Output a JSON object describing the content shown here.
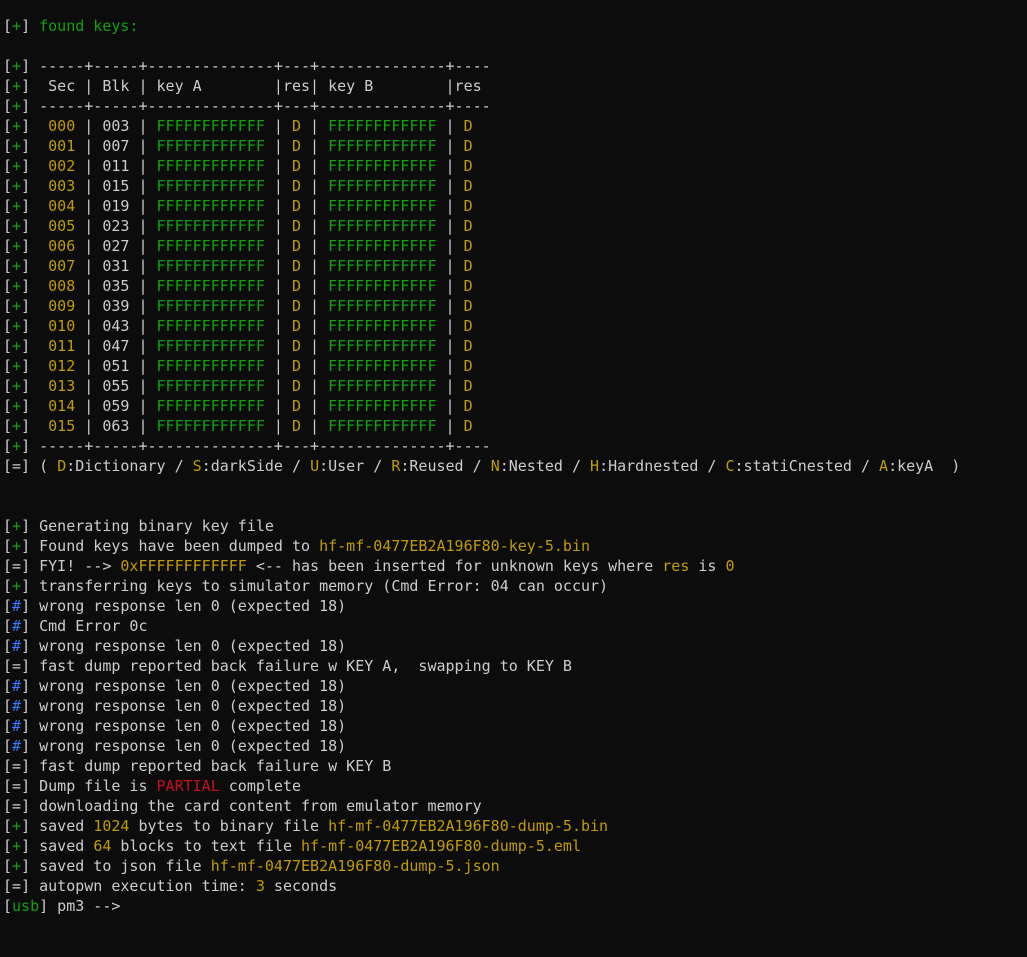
{
  "colors": {
    "background": "#0c0c0c",
    "text": "#cccccc",
    "green": "#13a10e",
    "yellow": "#c19c00",
    "red": "#c50f1f",
    "blue": "#3b78ff"
  },
  "header": {
    "prefix": "[+]",
    "title": "found keys:"
  },
  "table": {
    "prefix": "[+]",
    "border_top": " -----+-----+--------------+---+--------------+----",
    "header_line": "  Sec | Blk | key A        |res| key B        |res",
    "border_mid": " -----+-----+--------------+---+--------------+----",
    "border_bottom": " -----+-----+--------------+---+--------------+----",
    "rows": [
      {
        "sec": "000",
        "blk": "003",
        "keyA": "FFFFFFFFFFFF",
        "resA": "D",
        "keyB": "FFFFFFFFFFFF",
        "resB": "D"
      },
      {
        "sec": "001",
        "blk": "007",
        "keyA": "FFFFFFFFFFFF",
        "resA": "D",
        "keyB": "FFFFFFFFFFFF",
        "resB": "D"
      },
      {
        "sec": "002",
        "blk": "011",
        "keyA": "FFFFFFFFFFFF",
        "resA": "D",
        "keyB": "FFFFFFFFFFFF",
        "resB": "D"
      },
      {
        "sec": "003",
        "blk": "015",
        "keyA": "FFFFFFFFFFFF",
        "resA": "D",
        "keyB": "FFFFFFFFFFFF",
        "resB": "D"
      },
      {
        "sec": "004",
        "blk": "019",
        "keyA": "FFFFFFFFFFFF",
        "resA": "D",
        "keyB": "FFFFFFFFFFFF",
        "resB": "D"
      },
      {
        "sec": "005",
        "blk": "023",
        "keyA": "FFFFFFFFFFFF",
        "resA": "D",
        "keyB": "FFFFFFFFFFFF",
        "resB": "D"
      },
      {
        "sec": "006",
        "blk": "027",
        "keyA": "FFFFFFFFFFFF",
        "resA": "D",
        "keyB": "FFFFFFFFFFFF",
        "resB": "D"
      },
      {
        "sec": "007",
        "blk": "031",
        "keyA": "FFFFFFFFFFFF",
        "resA": "D",
        "keyB": "FFFFFFFFFFFF",
        "resB": "D"
      },
      {
        "sec": "008",
        "blk": "035",
        "keyA": "FFFFFFFFFFFF",
        "resA": "D",
        "keyB": "FFFFFFFFFFFF",
        "resB": "D"
      },
      {
        "sec": "009",
        "blk": "039",
        "keyA": "FFFFFFFFFFFF",
        "resA": "D",
        "keyB": "FFFFFFFFFFFF",
        "resB": "D"
      },
      {
        "sec": "010",
        "blk": "043",
        "keyA": "FFFFFFFFFFFF",
        "resA": "D",
        "keyB": "FFFFFFFFFFFF",
        "resB": "D"
      },
      {
        "sec": "011",
        "blk": "047",
        "keyA": "FFFFFFFFFFFF",
        "resA": "D",
        "keyB": "FFFFFFFFFFFF",
        "resB": "D"
      },
      {
        "sec": "012",
        "blk": "051",
        "keyA": "FFFFFFFFFFFF",
        "resA": "D",
        "keyB": "FFFFFFFFFFFF",
        "resB": "D"
      },
      {
        "sec": "013",
        "blk": "055",
        "keyA": "FFFFFFFFFFFF",
        "resA": "D",
        "keyB": "FFFFFFFFFFFF",
        "resB": "D"
      },
      {
        "sec": "014",
        "blk": "059",
        "keyA": "FFFFFFFFFFFF",
        "resA": "D",
        "keyB": "FFFFFFFFFFFF",
        "resB": "D"
      },
      {
        "sec": "015",
        "blk": "063",
        "keyA": "FFFFFFFFFFFF",
        "resA": "D",
        "keyB": "FFFFFFFFFFFF",
        "resB": "D"
      }
    ]
  },
  "legend": {
    "prefix": "[=]",
    "items": [
      {
        "letter": "D",
        "text": ":Dictionary"
      },
      {
        "letter": "S",
        "text": ":darkSide"
      },
      {
        "letter": "U",
        "text": ":User"
      },
      {
        "letter": "R",
        "text": ":Reused"
      },
      {
        "letter": "N",
        "text": ":Nested"
      },
      {
        "letter": "H",
        "text": ":Hardnested"
      },
      {
        "letter": "C",
        "text": ":statiCnested"
      },
      {
        "letter": "A",
        "text": ":keyA"
      }
    ]
  },
  "log": [
    {
      "prefix": "[+]",
      "pcolor": "green",
      "segments": [
        {
          "t": "Generating binary key file"
        }
      ]
    },
    {
      "prefix": "[+]",
      "pcolor": "green",
      "segments": [
        {
          "t": "Found keys have been dumped to "
        },
        {
          "t": "hf-mf-0477EB2A196F80-key-5.bin",
          "c": "yellow"
        }
      ]
    },
    {
      "prefix": "[=]",
      "pcolor": "white",
      "segments": [
        {
          "t": "FYI! --> "
        },
        {
          "t": "0xFFFFFFFFFFFF",
          "c": "yellow"
        },
        {
          "t": " <-- has been inserted for unknown keys where "
        },
        {
          "t": "res",
          "c": "yellow"
        },
        {
          "t": " is "
        },
        {
          "t": "0",
          "c": "yellow"
        }
      ]
    },
    {
      "prefix": "[+]",
      "pcolor": "green",
      "segments": [
        {
          "t": "transferring keys to simulator memory (Cmd Error: 04 can occur)"
        }
      ]
    },
    {
      "prefix": "[#]",
      "pcolor": "blue",
      "segments": [
        {
          "t": "wrong response len 0 (expected 18)"
        }
      ]
    },
    {
      "prefix": "[#]",
      "pcolor": "blue",
      "segments": [
        {
          "t": "Cmd Error 0c"
        }
      ]
    },
    {
      "prefix": "[#]",
      "pcolor": "blue",
      "segments": [
        {
          "t": "wrong response len 0 (expected 18)"
        }
      ]
    },
    {
      "prefix": "[=]",
      "pcolor": "white",
      "segments": [
        {
          "t": "fast dump reported back failure w KEY A,  swapping to KEY B"
        }
      ]
    },
    {
      "prefix": "[#]",
      "pcolor": "blue",
      "segments": [
        {
          "t": "wrong response len 0 (expected 18)"
        }
      ]
    },
    {
      "prefix": "[#]",
      "pcolor": "blue",
      "segments": [
        {
          "t": "wrong response len 0 (expected 18)"
        }
      ]
    },
    {
      "prefix": "[#]",
      "pcolor": "blue",
      "segments": [
        {
          "t": "wrong response len 0 (expected 18)"
        }
      ]
    },
    {
      "prefix": "[#]",
      "pcolor": "blue",
      "segments": [
        {
          "t": "wrong response len 0 (expected 18)"
        }
      ]
    },
    {
      "prefix": "[=]",
      "pcolor": "white",
      "segments": [
        {
          "t": "fast dump reported back failure w KEY B"
        }
      ]
    },
    {
      "prefix": "[=]",
      "pcolor": "white",
      "segments": [
        {
          "t": "Dump file is "
        },
        {
          "t": "PARTIAL",
          "c": "red"
        },
        {
          "t": " complete"
        }
      ]
    },
    {
      "prefix": "[=]",
      "pcolor": "white",
      "segments": [
        {
          "t": "downloading the card content from emulator memory"
        }
      ]
    },
    {
      "prefix": "[+]",
      "pcolor": "green",
      "segments": [
        {
          "t": "saved "
        },
        {
          "t": "1024",
          "c": "yellow"
        },
        {
          "t": " bytes to binary file "
        },
        {
          "t": "hf-mf-0477EB2A196F80-dump-5.bin",
          "c": "yellow"
        }
      ]
    },
    {
      "prefix": "[+]",
      "pcolor": "green",
      "segments": [
        {
          "t": "saved "
        },
        {
          "t": "64",
          "c": "yellow"
        },
        {
          "t": " blocks to text file "
        },
        {
          "t": "hf-mf-0477EB2A196F80-dump-5.eml",
          "c": "yellow"
        }
      ]
    },
    {
      "prefix": "[+]",
      "pcolor": "green",
      "segments": [
        {
          "t": "saved to json file "
        },
        {
          "t": "hf-mf-0477EB2A196F80-dump-5.json",
          "c": "yellow"
        }
      ]
    },
    {
      "prefix": "[=]",
      "pcolor": "white",
      "segments": [
        {
          "t": "autopwn execution time: "
        },
        {
          "t": "3",
          "c": "yellow"
        },
        {
          "t": " seconds"
        }
      ]
    }
  ],
  "prompt": {
    "device": "usb",
    "text": "] pm3 -->"
  }
}
